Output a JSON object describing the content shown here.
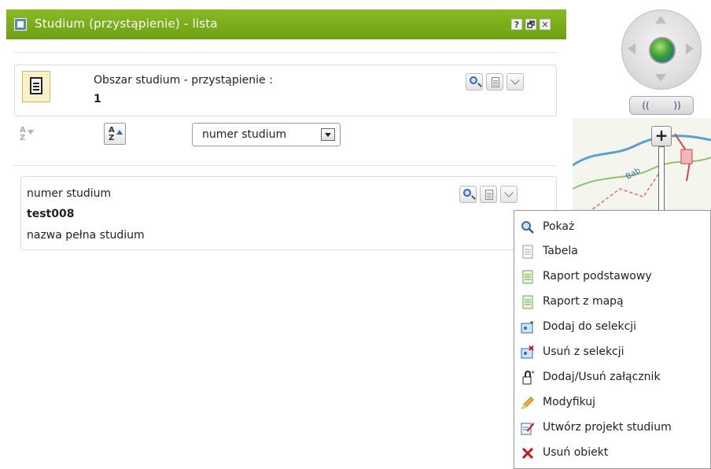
{
  "window": {
    "title": "Studium (przystąpienie) - lista",
    "help_label": "?",
    "restore_label": "🗗",
    "close_label": "✕"
  },
  "header_card": {
    "label": "Obszar studium - przystąpienie :",
    "count": "1"
  },
  "sort": {
    "field_value": "numer studium"
  },
  "record": {
    "field_label": "numer studium",
    "field_value": "test008",
    "second_label": "nazwa pełna studium"
  },
  "navigation": {
    "pan_left": "((",
    "pan_right": "))",
    "zoom_in": "+"
  },
  "context_menu": {
    "items": [
      {
        "label": "Pokaż",
        "icon": "magnifier-icon"
      },
      {
        "label": "Tabela",
        "icon": "table-page-icon"
      },
      {
        "label": "Raport podstawowy",
        "icon": "report-icon"
      },
      {
        "label": "Raport z mapą",
        "icon": "report-map-icon"
      },
      {
        "label": "Dodaj do selekcji",
        "icon": "add-selection-icon"
      },
      {
        "label": "Usuń z selekcji",
        "icon": "remove-selection-icon"
      },
      {
        "label": "Dodaj/Usuń załącznik",
        "icon": "attachment-icon"
      },
      {
        "label": "Modyfikuj",
        "icon": "pencil-icon"
      },
      {
        "label": "Utwórz projekt studium",
        "icon": "create-project-icon"
      },
      {
        "label": "Usuń obiekt",
        "icon": "delete-x-icon"
      }
    ]
  },
  "colors": {
    "titlebar": "#7aab1a",
    "accent_blue": "#2e6bb8",
    "delete_red": "#d01010"
  }
}
